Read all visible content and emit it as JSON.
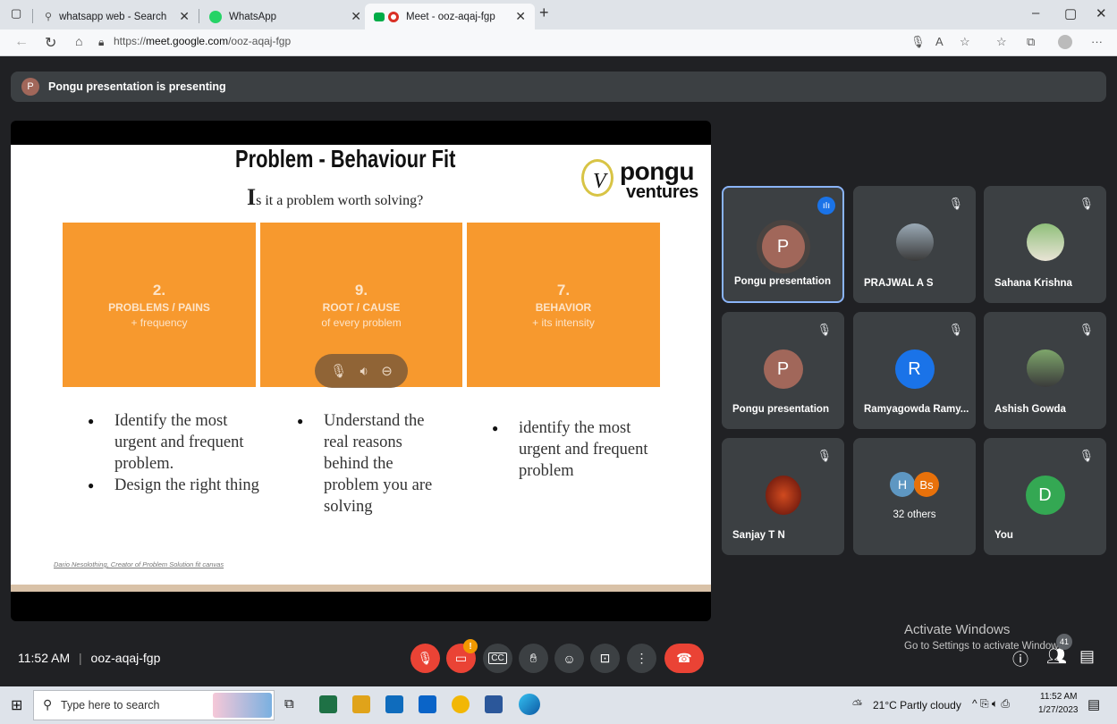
{
  "browser": {
    "tabs": [
      {
        "label": "whatsapp web - Search",
        "icon": "search-icon",
        "active": false
      },
      {
        "label": "WhatsApp",
        "icon": "whatsapp-icon",
        "active": false
      },
      {
        "label": "Meet - ooz-aqaj-fgp",
        "icon": "meet-icon",
        "active": true
      }
    ],
    "url_prefix": "https://",
    "url_host": "meet.google.com",
    "url_path": "/ooz-aqaj-fgp"
  },
  "meet": {
    "presenting_avatar": "P",
    "presenting_text": "Pongu presentation is presenting",
    "slide": {
      "title": "Problem - Behaviour Fit",
      "subtitle_cap": "I",
      "subtitle_rest": "s it a problem worth solving?",
      "logo_top": "pongu",
      "logo_bottom": "ventures",
      "logo_mark": "V",
      "boxes": [
        {
          "num": "2.",
          "label": "PROBLEMS / PAINS",
          "sub": "+ frequency"
        },
        {
          "num": "9.",
          "label": "ROOT / CAUSE",
          "sub": "of every problem"
        },
        {
          "num": "7.",
          "label": "BEHAVIOR",
          "sub": "+ its intensity"
        }
      ],
      "col1_b1": "Identify the most urgent and frequent problem.",
      "col1_b2": "Design the right thing",
      "col2_b1": "Understand the real reasons behind the problem you are solving",
      "col3_b1": "identify the most urgent and frequent problem",
      "credit": "Dario Nesolothing, Creator of Problem Solution fit canvas"
    },
    "tiles": [
      {
        "name": "Pongu presentation",
        "avatar": "P",
        "color": "#a1675a"
      },
      {
        "name": "PRAJWAL A S",
        "avatar": "photo"
      },
      {
        "name": "Sahana Krishna",
        "avatar": "photo"
      },
      {
        "name": "Pongu presentation",
        "avatar": "P",
        "color": "#a1675a"
      },
      {
        "name": "Ramyagowda Ramy...",
        "avatar": "R",
        "color": "#1a73e8"
      },
      {
        "name": "Ashish Gowda",
        "avatar": "photo"
      },
      {
        "name": "Sanjay T N",
        "avatar": "photo"
      },
      {
        "name": "32 others",
        "avatar_a": "H",
        "avatar_b": "Bs"
      },
      {
        "name": "You",
        "avatar": "D",
        "color": "#34a853"
      }
    ],
    "time": "11:52 AM",
    "meeting_code": "ooz-aqaj-fgp",
    "participants_count": "41",
    "warning_badge": "!",
    "activate_title": "Activate Windows",
    "activate_sub": "Go to Settings to activate Windows."
  },
  "taskbar": {
    "search_placeholder": "Type here to search",
    "weather": "21°C  Partly cloudy",
    "clock_time": "11:52 AM",
    "clock_date": "1/27/2023"
  }
}
